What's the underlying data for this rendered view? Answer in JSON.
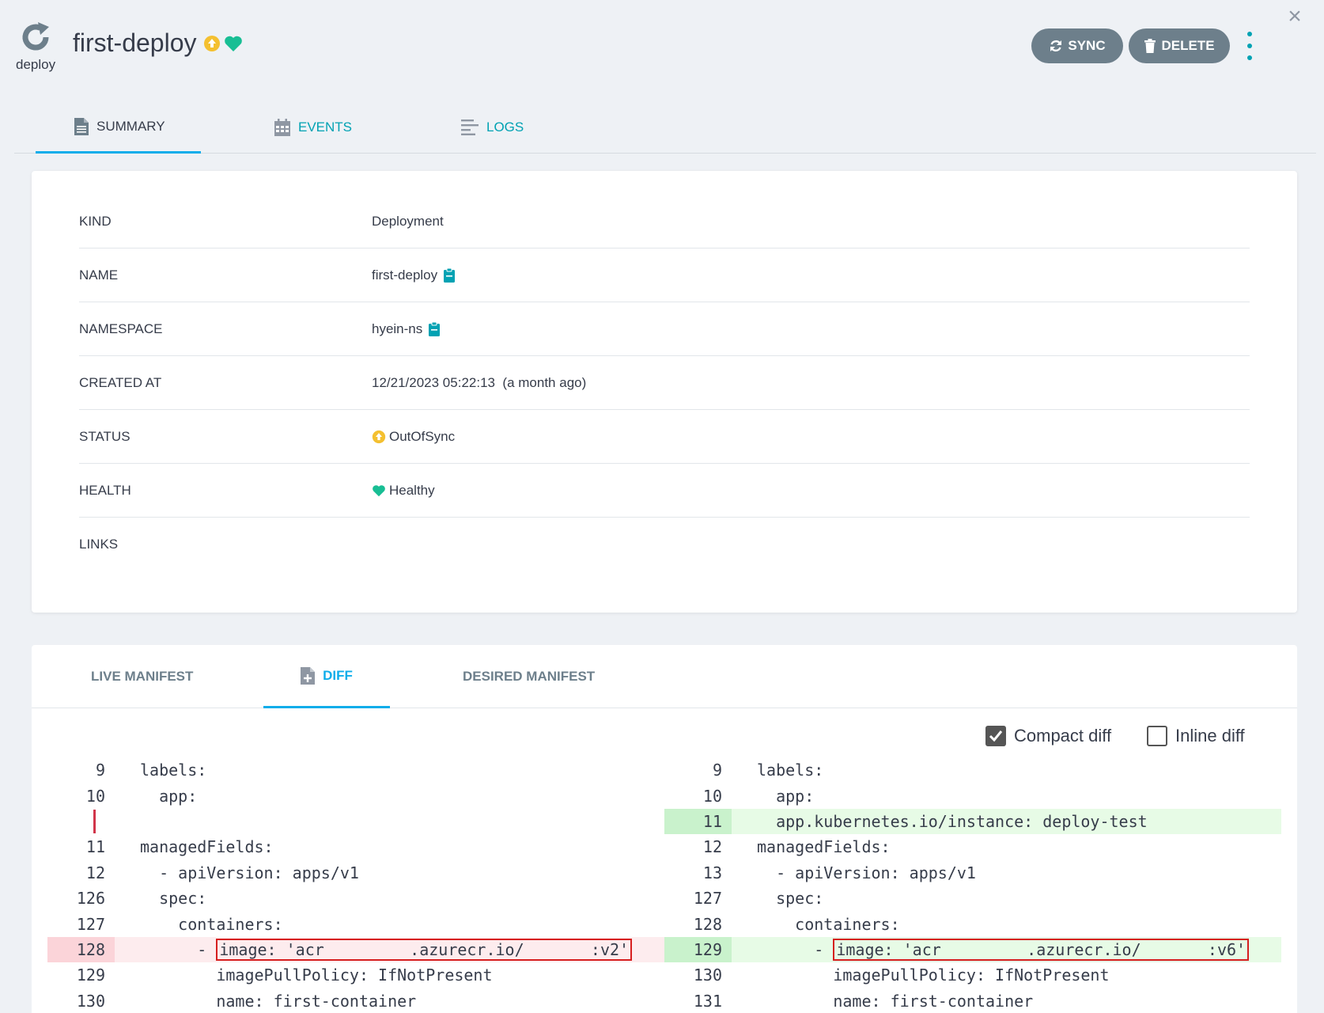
{
  "header": {
    "kind_label": "deploy",
    "title": "first-deploy",
    "sync_label": "SYNC",
    "delete_label": "DELETE",
    "close_glyph": "×"
  },
  "colors": {
    "accent": "#00a2b3",
    "tab_underline": "#0dadea",
    "button_bg": "#6d7f8b",
    "out_of_sync": "#f4c030",
    "healthy": "#18be94",
    "diff_removed": "#fdecee",
    "diff_added": "#e7fbe6",
    "highlight_box": "#d61f1f"
  },
  "tabs": [
    {
      "label": "SUMMARY",
      "icon": "document-icon",
      "active": true
    },
    {
      "label": "EVENTS",
      "icon": "calendar-icon",
      "active": false
    },
    {
      "label": "LOGS",
      "icon": "logs-icon",
      "active": false
    }
  ],
  "summary": {
    "rows": [
      {
        "key": "KIND",
        "value": "Deployment"
      },
      {
        "key": "NAME",
        "value": "first-deploy"
      },
      {
        "key": "NAMESPACE",
        "value": "hyein-ns"
      },
      {
        "key": "CREATED AT",
        "value": "12/21/2023 05:22:13  (a month ago)"
      },
      {
        "key": "STATUS",
        "value": "OutOfSync"
      },
      {
        "key": "HEALTH",
        "value": "Healthy"
      },
      {
        "key": "LINKS",
        "value": ""
      }
    ]
  },
  "manifest": {
    "tabs": [
      {
        "label": "LIVE MANIFEST",
        "active": false
      },
      {
        "label": "DIFF",
        "icon": "file-plus-icon",
        "active": true
      },
      {
        "label": "DESIRED MANIFEST",
        "active": false
      }
    ],
    "compact_diff_label": "Compact diff",
    "compact_diff_checked": true,
    "inline_diff_label": "Inline diff",
    "inline_diff_checked": false,
    "left": [
      {
        "ln": "9",
        "code": "labels:",
        "type": "normal"
      },
      {
        "ln": "10",
        "code": "  app:",
        "type": "normal"
      },
      {
        "ln": "",
        "code": "",
        "type": "gap"
      },
      {
        "ln": "11",
        "code": "managedFields:",
        "type": "normal"
      },
      {
        "ln": "12",
        "code": "  - apiVersion: apps/v1",
        "type": "normal"
      },
      {
        "ln": "126",
        "code": "  spec:",
        "type": "normal"
      },
      {
        "ln": "127",
        "code": "    containers:",
        "type": "normal"
      },
      {
        "ln": "128",
        "prefix": "      - ",
        "code": "image: 'acr         .azurecr.io/       :v2'",
        "type": "del",
        "boxed": true
      },
      {
        "ln": "129",
        "code": "        imagePullPolicy: IfNotPresent",
        "type": "normal"
      },
      {
        "ln": "130",
        "code": "        name: first-container",
        "type": "normal"
      }
    ],
    "right": [
      {
        "ln": "9",
        "code": "labels:",
        "type": "normal"
      },
      {
        "ln": "10",
        "code": "  app:",
        "type": "normal"
      },
      {
        "ln": "11",
        "code": "  app.kubernetes.io/instance: deploy-test",
        "type": "add"
      },
      {
        "ln": "12",
        "code": "managedFields:",
        "type": "normal"
      },
      {
        "ln": "13",
        "code": "  - apiVersion: apps/v1",
        "type": "normal"
      },
      {
        "ln": "127",
        "code": "  spec:",
        "type": "normal"
      },
      {
        "ln": "128",
        "code": "    containers:",
        "type": "normal"
      },
      {
        "ln": "129",
        "prefix": "      - ",
        "code": "image: 'acr         .azurecr.io/       :v6'",
        "type": "add",
        "boxed": true
      },
      {
        "ln": "130",
        "code": "        imagePullPolicy: IfNotPresent",
        "type": "normal"
      },
      {
        "ln": "131",
        "code": "        name: first-container",
        "type": "normal"
      }
    ]
  }
}
